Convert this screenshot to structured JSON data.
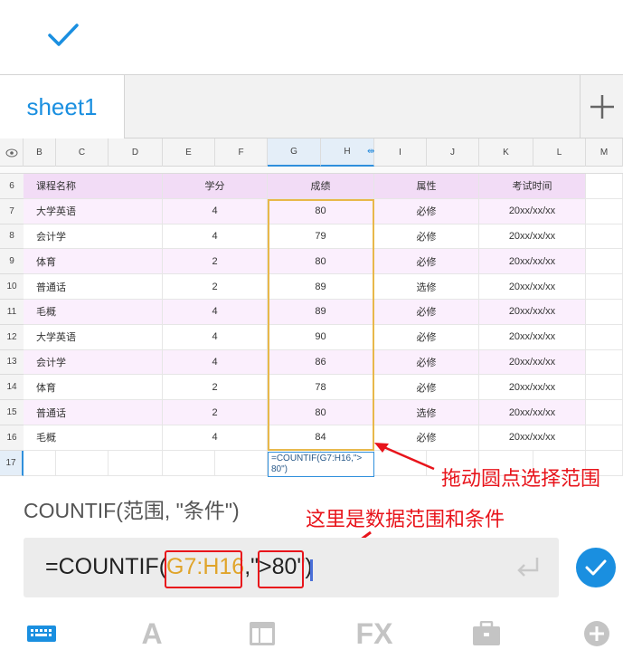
{
  "sheet_tab": {
    "label": "sheet1"
  },
  "columns": [
    "B",
    "C",
    "D",
    "E",
    "F",
    "G",
    "H",
    "I",
    "J",
    "K",
    "L",
    "M"
  ],
  "table": {
    "header_row": "6",
    "headers": [
      "课程名称",
      "学分",
      "成绩",
      "属性",
      "考试时间"
    ],
    "rows": [
      {
        "row": "7",
        "name": "大学英语",
        "credit": "4",
        "score": "80",
        "attr": "必修",
        "time": "20xx/xx/xx"
      },
      {
        "row": "8",
        "name": "会计学",
        "credit": "4",
        "score": "79",
        "attr": "必修",
        "time": "20xx/xx/xx"
      },
      {
        "row": "9",
        "name": "体育",
        "credit": "2",
        "score": "80",
        "attr": "必修",
        "time": "20xx/xx/xx"
      },
      {
        "row": "10",
        "name": "普通话",
        "credit": "2",
        "score": "89",
        "attr": "选修",
        "time": "20xx/xx/xx"
      },
      {
        "row": "11",
        "name": "毛概",
        "credit": "4",
        "score": "89",
        "attr": "必修",
        "time": "20xx/xx/xx"
      },
      {
        "row": "12",
        "name": "大学英语",
        "credit": "4",
        "score": "90",
        "attr": "必修",
        "time": "20xx/xx/xx"
      },
      {
        "row": "13",
        "name": "会计学",
        "credit": "4",
        "score": "86",
        "attr": "必修",
        "time": "20xx/xx/xx"
      },
      {
        "row": "14",
        "name": "体育",
        "credit": "2",
        "score": "78",
        "attr": "必修",
        "time": "20xx/xx/xx"
      },
      {
        "row": "15",
        "name": "普通话",
        "credit": "2",
        "score": "80",
        "attr": "选修",
        "time": "20xx/xx/xx"
      },
      {
        "row": "16",
        "name": "毛概",
        "credit": "4",
        "score": "84",
        "attr": "必修",
        "time": "20xx/xx/xx"
      }
    ],
    "row17": "17"
  },
  "cell_editor": {
    "line1": "=COUNTIF(G7:H16,\">",
    "line2": "80\")"
  },
  "annotations": {
    "drag": "拖动圆点选择范围",
    "range": "这里是数据范围和条件"
  },
  "formula_hint": "COUNTIF(范围, \"条件\")",
  "formula_input": {
    "prefix": "=COUNTIF(",
    "range": "G7:H16",
    "sep": ",\"",
    "cond": ">80",
    "suffix": "\")"
  },
  "toolbar": {
    "format_label": "A",
    "fx_label": "FX"
  },
  "colors": {
    "accent": "#1a8fe0",
    "header_fill": "#f2dcf6",
    "stripe": "#fbeffd",
    "selection": "#e8b84a",
    "annotation": "#e8141b"
  }
}
